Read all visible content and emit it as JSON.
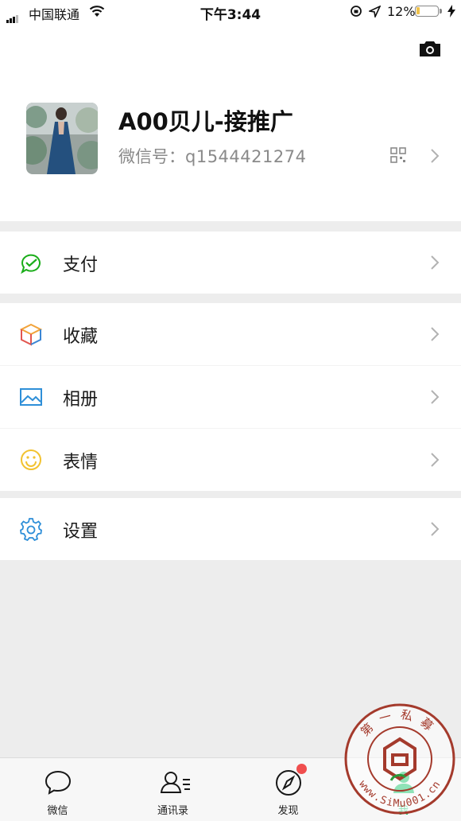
{
  "status_bar": {
    "carrier": "中国联通",
    "time": "下午3:44",
    "battery_percent": "12%"
  },
  "profile": {
    "name": "A00贝儿-接推广",
    "wechat_id_label": "微信号：",
    "wechat_id_value": "q1544421274"
  },
  "menu": [
    {
      "label": "支付",
      "icon": "wallet-check-icon"
    },
    {
      "label": "收藏",
      "icon": "cube-icon"
    },
    {
      "label": "相册",
      "icon": "picture-icon"
    },
    {
      "label": "表情",
      "icon": "smiley-icon"
    },
    {
      "label": "设置",
      "icon": "gear-icon"
    }
  ],
  "tabbar": [
    {
      "label": "微信",
      "icon": "chat-bubble-icon"
    },
    {
      "label": "通讯录",
      "icon": "contacts-icon"
    },
    {
      "label": "发现",
      "icon": "compass-icon",
      "badge": "red-dot"
    },
    {
      "label": "我",
      "icon": "me-icon"
    }
  ],
  "watermark": {
    "top_text": "第一私募",
    "bottom_text": "www.SiMu001.cn"
  },
  "colors": {
    "accent_green": "#07c160",
    "badge_red": "#f04e4e",
    "background": "#ededed"
  }
}
